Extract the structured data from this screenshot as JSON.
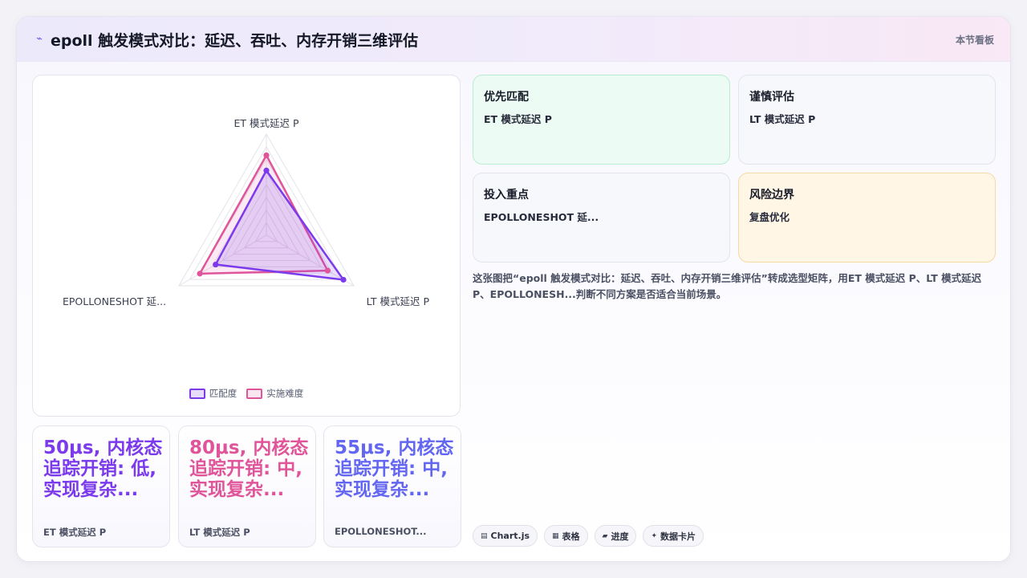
{
  "header": {
    "icon": "pulse-icon",
    "title": "epoll 触发模式对比：延迟、吞吐、内存开销三维评估",
    "link": "本节看板"
  },
  "chart_data": {
    "type": "radar",
    "axes": [
      "ET 模式延迟 P",
      "LT 模式延迟 P",
      "EPOLLONESHOT 延..."
    ],
    "range": [
      0,
      100
    ],
    "grid": true,
    "legend": "bottom",
    "series": [
      {
        "name": "匹配度",
        "color": "#7c3aed",
        "values": [
          64,
          88,
          58
        ]
      },
      {
        "name": "实施难度",
        "color": "#e0559a",
        "values": [
          79,
          70,
          76
        ]
      }
    ]
  },
  "stats": [
    {
      "value": "50μs, 内核态追踪开销: 低, 实现复杂...",
      "label": "ET 模式延迟 P",
      "color": "#7c3aed"
    },
    {
      "value": "80μs, 内核态追踪开销: 中, 实现复杂...",
      "label": "LT 模式延迟 P",
      "color": "#e0559a"
    },
    {
      "value": "55μs, 内核态追踪开销: 中, 实现复杂...",
      "label": "EPOLLONESHOT...",
      "color": "#6366f1"
    }
  ],
  "tiles": [
    {
      "title": "优先匹配",
      "text": "ET 模式延迟 P",
      "bg": "#ecfbf3",
      "border": "#b9ecd0"
    },
    {
      "title": "谨慎评估",
      "text": "LT 模式延迟 P",
      "bg": "#f7f8fc",
      "border": "#e2e4ee"
    },
    {
      "title": "投入重点",
      "text": "EPOLLONESHOT 延...",
      "bg": "#f7f8fc",
      "border": "#e2e4ee"
    },
    {
      "title": "风险边界",
      "text": "复盘优化",
      "bg": "#fff6e6",
      "border": "#f5d9a6"
    }
  ],
  "description": "这张图把“epoll 触发模式对比：延迟、吞吐、内存开销三维评估”转成选型矩阵，用ET 模式延迟 P、LT 模式延迟 P、EPOLLONESH...判断不同方案是否适合当前场景。",
  "tags": [
    {
      "icon": "chart-icon",
      "glyph": "▤",
      "label": "Chart.js"
    },
    {
      "icon": "table-icon",
      "glyph": "▦",
      "label": "表格"
    },
    {
      "icon": "progress-icon",
      "glyph": "▰",
      "label": "进度"
    },
    {
      "icon": "sparkle-icon",
      "glyph": "✦",
      "label": "数据卡片"
    }
  ]
}
